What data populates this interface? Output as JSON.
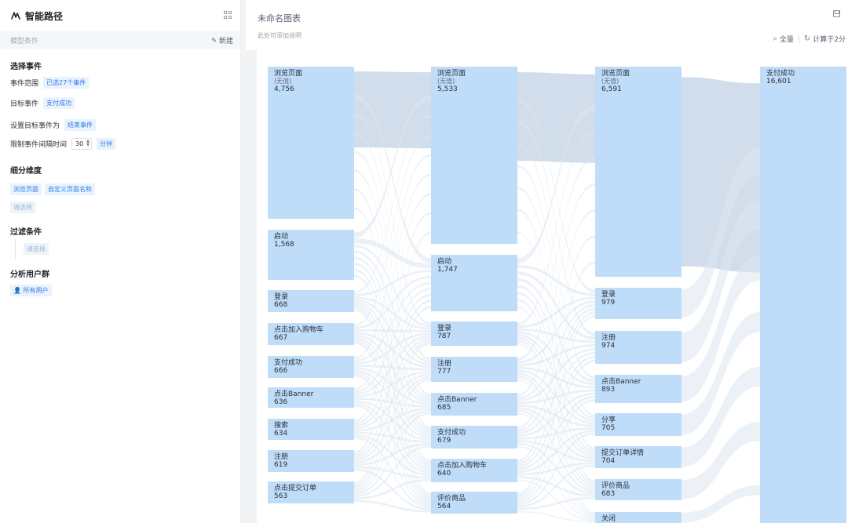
{
  "sidebar": {
    "title": "智能路径",
    "logo_icon": "path-logo-icon",
    "layout_icon": "grid-icon",
    "sub_label": "模型条件",
    "new_label": "新建",
    "sections": {
      "select_event": "选择事件",
      "dimension": "细分维度",
      "filter": "过滤条件",
      "user_group": "分析用户群"
    },
    "event_range_label": "事件范围",
    "event_range_value": "已选27个事件",
    "target_event_label": "目标事件",
    "target_event_value": "支付成功",
    "set_target_label": "设置目标事件为",
    "set_target_value": "结束事件",
    "interval_label": "限制事件间隔时间",
    "interval_value": "30",
    "interval_unit": "分钟",
    "dim_tags": [
      "浏览页面",
      "自定义页面名称"
    ],
    "dim_placeholder": "请选择",
    "filter_placeholder": "请选择",
    "user_group_value": "所有用户"
  },
  "main": {
    "chart_title": "未命名图表",
    "chart_desc": "此处可添加说明",
    "tool_full": "全量",
    "tool_calc": "计算于2分",
    "save_icon": "save-icon"
  },
  "colors": {
    "node": "#bfdcf9",
    "link": "#dde6f0",
    "link_dark": "#c9d7e6",
    "accent": "#2f7ee8"
  },
  "chart_data": {
    "type": "sankey",
    "columns": [
      [
        {
          "name": "浏览页面",
          "sub": "(无值)",
          "value": "4,756"
        },
        {
          "name": "启动",
          "value": "1,568"
        },
        {
          "name": "登录",
          "value": "668"
        },
        {
          "name": "点击加入购物车",
          "value": "667"
        },
        {
          "name": "支付成功",
          "value": "666"
        },
        {
          "name": "点击Banner",
          "value": "636"
        },
        {
          "name": "搜索",
          "value": "634"
        },
        {
          "name": "注册",
          "value": "619"
        },
        {
          "name": "点击提交订单",
          "value": "563"
        }
      ],
      [
        {
          "name": "浏览页面",
          "sub": "(无值)",
          "value": "5,533"
        },
        {
          "name": "启动",
          "value": "1,747"
        },
        {
          "name": "登录",
          "value": "787"
        },
        {
          "name": "注册",
          "value": "777"
        },
        {
          "name": "点击Banner",
          "value": "685"
        },
        {
          "name": "支付成功",
          "value": "679"
        },
        {
          "name": "点击加入购物车",
          "value": "640"
        },
        {
          "name": "评价商品",
          "value": "564"
        }
      ],
      [
        {
          "name": "浏览页面",
          "sub": "(无值)",
          "value": "6,591"
        },
        {
          "name": "登录",
          "value": "979"
        },
        {
          "name": "注册",
          "value": "974"
        },
        {
          "name": "点击Banner",
          "value": "893"
        },
        {
          "name": "分享",
          "value": "705"
        },
        {
          "name": "提交订单详情",
          "value": "704"
        },
        {
          "name": "评价商品",
          "value": "683"
        },
        {
          "name": "关闭",
          "value": ""
        }
      ],
      [
        {
          "name": "支付成功",
          "value": "16,601"
        }
      ]
    ]
  }
}
